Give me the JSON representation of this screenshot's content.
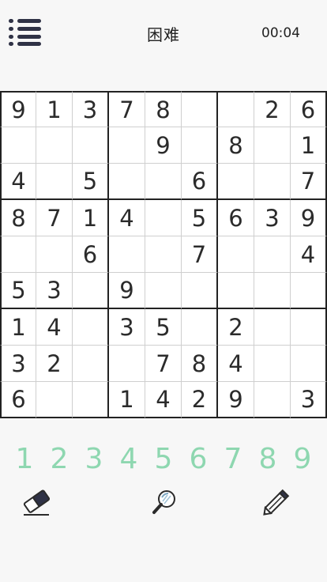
{
  "header": {
    "menu_icon": "menu-icon",
    "title": "困难",
    "timer": "00:04"
  },
  "board": {
    "rows": [
      [
        "9",
        "1",
        "3",
        "7",
        "8",
        "",
        "",
        "2",
        "6"
      ],
      [
        "",
        "",
        "",
        "",
        "9",
        "",
        "8",
        "",
        "1"
      ],
      [
        "4",
        "",
        "5",
        "",
        "",
        "6",
        "",
        "",
        "7"
      ],
      [
        "8",
        "7",
        "1",
        "4",
        "",
        "5",
        "6",
        "3",
        "9"
      ],
      [
        "",
        "",
        "6",
        "",
        "",
        "7",
        "",
        "",
        "4"
      ],
      [
        "5",
        "3",
        "",
        "9",
        "",
        "",
        "",
        "",
        ""
      ],
      [
        "1",
        "4",
        "",
        "3",
        "5",
        "",
        "2",
        "",
        ""
      ],
      [
        "3",
        "2",
        "",
        "",
        "7",
        "8",
        "4",
        "",
        ""
      ],
      [
        "6",
        "",
        "",
        "1",
        "4",
        "2",
        "9",
        "",
        "3"
      ]
    ]
  },
  "keypad": {
    "keys": [
      "1",
      "2",
      "3",
      "4",
      "5",
      "6",
      "7",
      "8",
      "9"
    ],
    "color": "#8ed7b0"
  },
  "tools": {
    "eraser_icon": "eraser-icon",
    "hint_icon": "magnifier-icon",
    "pencil_icon": "pencil-icon"
  }
}
